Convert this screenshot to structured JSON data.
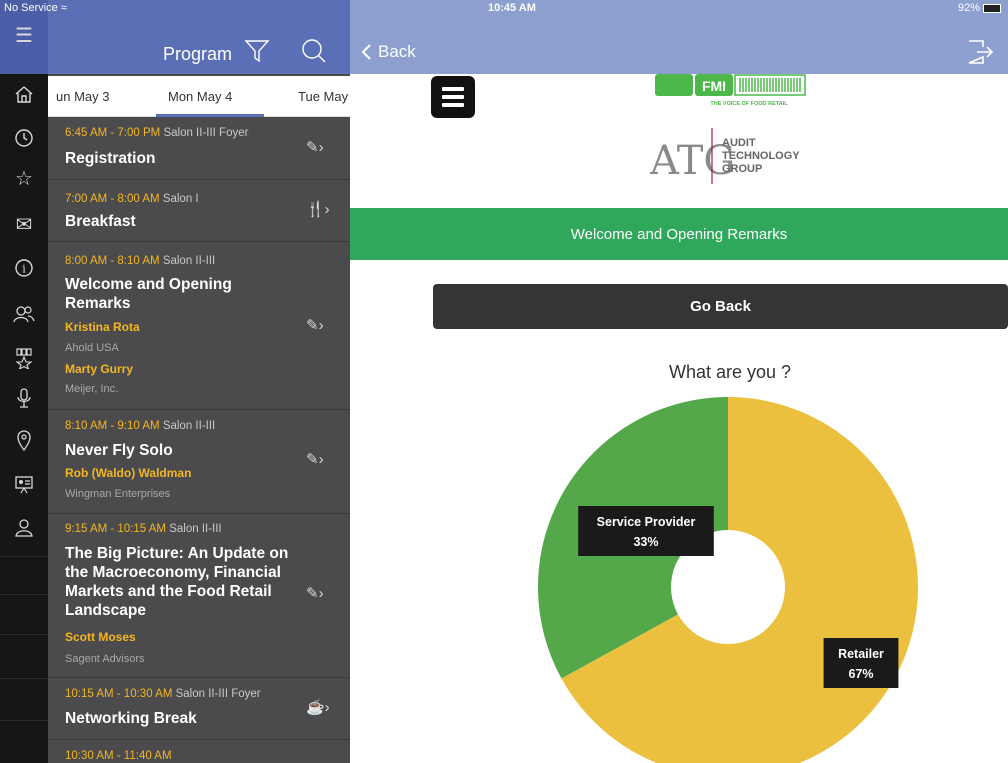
{
  "status_bar": {
    "carrier": "No Service",
    "time": "10:45 AM",
    "battery": "92%"
  },
  "program": {
    "title": "Program",
    "day_tabs": [
      {
        "label": "un May 3"
      },
      {
        "label": "Mon May 4"
      },
      {
        "label": "Tue May"
      }
    ],
    "sessions": [
      {
        "time": "6:45 AM - 7:00 PM",
        "room": "Salon II-III Foyer",
        "title": "Registration",
        "speakers": [],
        "action_icon": "pencil-chevron-icon"
      },
      {
        "time": "7:00 AM - 8:00 AM",
        "room": "Salon I",
        "title": "Breakfast",
        "speakers": [],
        "action_icon": "fork-knife-chevron-icon"
      },
      {
        "time": "8:00 AM - 8:10 AM",
        "room": "Salon II-III",
        "title": "Welcome and Opening Remarks",
        "speakers": [
          {
            "name": "Kristina Rota",
            "org": "Ahold USA"
          },
          {
            "name": "Marty Gurry",
            "org": "Meijer, Inc."
          }
        ],
        "action_icon": "pencil-chevron-icon"
      },
      {
        "time": "8:10 AM - 9:10 AM",
        "room": "Salon II-III",
        "title": "Never Fly Solo",
        "speakers": [
          {
            "name": "Rob (Waldo) Waldman",
            "org": "Wingman Enterprises"
          }
        ],
        "action_icon": "pencil-chevron-icon"
      },
      {
        "time": "9:15 AM - 10:15 AM",
        "room": "Salon II-III",
        "title": "The Big Picture: An Update on the Macroeconomy, Financial Markets and the Food Retail Landscape",
        "speakers": [
          {
            "name": "Scott Moses",
            "org": "Sagent Advisors"
          }
        ],
        "action_icon": "pencil-chevron-icon"
      },
      {
        "time": "10:15 AM - 10:30 AM",
        "room": "Salon II-III Foyer",
        "title": "Networking Break",
        "speakers": [],
        "action_icon": "coffee-chevron-icon"
      },
      {
        "time": "10:30 AM - 11:40 AM",
        "room": "",
        "title": "",
        "speakers": [],
        "action_icon": ""
      }
    ]
  },
  "nav": {
    "back_label": "Back"
  },
  "logos": {
    "fmi": {
      "mark": "FMI",
      "tagline": "THE VOICE OF FOOD RETAIL"
    },
    "atg": {
      "mark": "ATG",
      "line1": "AUDIT",
      "line2": "TECHNOLOGY",
      "line3": "GROUP"
    }
  },
  "banner": {
    "text": "Welcome and Opening Remarks"
  },
  "go_back_label": "Go Back",
  "colors": {
    "accent_green": "#2fa85c",
    "header_blue": "#5a6fb5",
    "time_yellow": "#f3b620",
    "slice_green": "#54a84a",
    "slice_yellow": "#ecc03f"
  },
  "chart_data": {
    "type": "pie",
    "title": "What are you ?",
    "categories": [
      "Service Provider",
      "Retailer"
    ],
    "values": [
      33,
      67
    ],
    "labels": [
      "33%",
      "67%"
    ],
    "donut": true,
    "colors": [
      "#54a84a",
      "#ecc03f"
    ]
  }
}
